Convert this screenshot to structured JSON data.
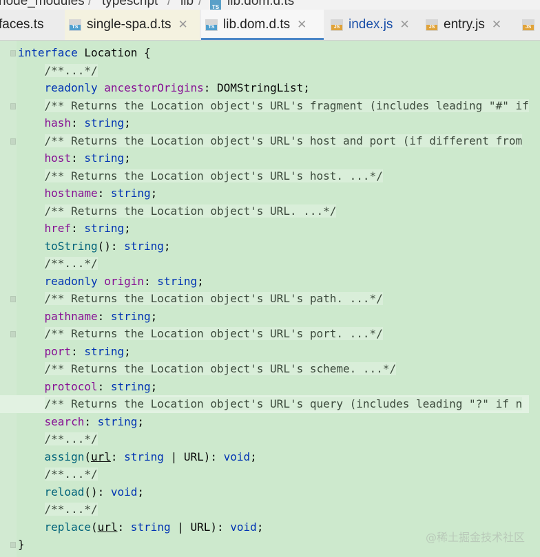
{
  "breadcrumb": {
    "items": [
      "node_modules",
      "typescript",
      "lib",
      "lib.dom.d.ts"
    ]
  },
  "tabs": [
    {
      "label": "faces.ts",
      "icon": "ts-file-icon",
      "state": "inactive"
    },
    {
      "label": "single-spa.d.ts",
      "icon": "ts-file-icon",
      "state": "inactive-alt"
    },
    {
      "label": "lib.dom.d.ts",
      "icon": "ts-file-icon",
      "state": "active"
    },
    {
      "label": "index.js",
      "icon": "js-file-icon",
      "state": "inactive"
    },
    {
      "label": "entry.js",
      "icon": "js-file-icon",
      "state": "inactive"
    }
  ],
  "icon_labels": {
    "ts": "TS",
    "js": "JS"
  },
  "code_lines": [
    [
      {
        "t": "interface",
        "c": "kw"
      },
      {
        "t": " Location {",
        "c": "punc"
      }
    ],
    [
      {
        "t": "    ",
        "c": "punc"
      },
      {
        "t": "/**...*/",
        "c": "cmt"
      }
    ],
    [
      {
        "t": "    ",
        "c": "punc"
      },
      {
        "t": "readonly",
        "c": "kw"
      },
      {
        "t": " ",
        "c": "punc"
      },
      {
        "t": "ancestorOrigins",
        "c": "prop"
      },
      {
        "t": ": DOMStringList;",
        "c": "punc"
      }
    ],
    [
      {
        "t": "    ",
        "c": "punc"
      },
      {
        "t": "/** Returns the Location object's URL's fragment (includes leading \"#\" if",
        "c": "cmt"
      }
    ],
    [
      {
        "t": "    ",
        "c": "punc"
      },
      {
        "t": "hash",
        "c": "prop"
      },
      {
        "t": ": ",
        "c": "punc"
      },
      {
        "t": "string",
        "c": "kw"
      },
      {
        "t": ";",
        "c": "punc"
      }
    ],
    [
      {
        "t": "    ",
        "c": "punc"
      },
      {
        "t": "/** Returns the Location object's URL's host and port (if different from",
        "c": "cmt"
      }
    ],
    [
      {
        "t": "    ",
        "c": "punc"
      },
      {
        "t": "host",
        "c": "prop"
      },
      {
        "t": ": ",
        "c": "punc"
      },
      {
        "t": "string",
        "c": "kw"
      },
      {
        "t": ";",
        "c": "punc"
      }
    ],
    [
      {
        "t": "    ",
        "c": "punc"
      },
      {
        "t": "/** Returns the Location object's URL's host. ...*/",
        "c": "cmt"
      }
    ],
    [
      {
        "t": "    ",
        "c": "punc"
      },
      {
        "t": "hostname",
        "c": "prop"
      },
      {
        "t": ": ",
        "c": "punc"
      },
      {
        "t": "string",
        "c": "kw"
      },
      {
        "t": ";",
        "c": "punc"
      }
    ],
    [
      {
        "t": "    ",
        "c": "punc"
      },
      {
        "t": "/** Returns the Location object's URL. ...*/",
        "c": "cmt"
      }
    ],
    [
      {
        "t": "    ",
        "c": "punc"
      },
      {
        "t": "href",
        "c": "prop"
      },
      {
        "t": ": ",
        "c": "punc"
      },
      {
        "t": "string",
        "c": "kw"
      },
      {
        "t": ";",
        "c": "punc"
      }
    ],
    [
      {
        "t": "    ",
        "c": "punc"
      },
      {
        "t": "toString",
        "c": "fn"
      },
      {
        "t": "(): ",
        "c": "punc"
      },
      {
        "t": "string",
        "c": "kw"
      },
      {
        "t": ";",
        "c": "punc"
      }
    ],
    [
      {
        "t": "    ",
        "c": "punc"
      },
      {
        "t": "/**...*/",
        "c": "cmt"
      }
    ],
    [
      {
        "t": "    ",
        "c": "punc"
      },
      {
        "t": "readonly",
        "c": "kw"
      },
      {
        "t": " ",
        "c": "punc"
      },
      {
        "t": "origin",
        "c": "prop"
      },
      {
        "t": ": ",
        "c": "punc"
      },
      {
        "t": "string",
        "c": "kw"
      },
      {
        "t": ";",
        "c": "punc"
      }
    ],
    [
      {
        "t": "    ",
        "c": "punc"
      },
      {
        "t": "/** Returns the Location object's URL's path. ...*/",
        "c": "cmt"
      }
    ],
    [
      {
        "t": "    ",
        "c": "punc"
      },
      {
        "t": "pathname",
        "c": "prop"
      },
      {
        "t": ": ",
        "c": "punc"
      },
      {
        "t": "string",
        "c": "kw"
      },
      {
        "t": ";",
        "c": "punc"
      }
    ],
    [
      {
        "t": "    ",
        "c": "punc"
      },
      {
        "t": "/** Returns the Location object's URL's port. ...*/",
        "c": "cmt"
      }
    ],
    [
      {
        "t": "    ",
        "c": "punc"
      },
      {
        "t": "port",
        "c": "prop"
      },
      {
        "t": ": ",
        "c": "punc"
      },
      {
        "t": "string",
        "c": "kw"
      },
      {
        "t": ";",
        "c": "punc"
      }
    ],
    [
      {
        "t": "    ",
        "c": "punc"
      },
      {
        "t": "/** Returns the Location object's URL's scheme. ...*/",
        "c": "cmt"
      }
    ],
    [
      {
        "t": "    ",
        "c": "punc"
      },
      {
        "t": "protocol",
        "c": "prop"
      },
      {
        "t": ": ",
        "c": "punc"
      },
      {
        "t": "string",
        "c": "kw"
      },
      {
        "t": ";",
        "c": "punc"
      }
    ],
    [
      {
        "t": "    ",
        "c": "punc"
      },
      {
        "t": "/** Returns the Location object's URL's query (includes leading \"?\" if n",
        "c": "cmt"
      }
    ],
    [
      {
        "t": "    ",
        "c": "punc"
      },
      {
        "t": "search",
        "c": "prop"
      },
      {
        "t": ": ",
        "c": "punc"
      },
      {
        "t": "string",
        "c": "kw"
      },
      {
        "t": ";",
        "c": "punc"
      }
    ],
    [
      {
        "t": "    ",
        "c": "punc"
      },
      {
        "t": "/**...*/",
        "c": "cmt"
      }
    ],
    [
      {
        "t": "    ",
        "c": "punc"
      },
      {
        "t": "assign",
        "c": "fn"
      },
      {
        "t": "(",
        "c": "punc"
      },
      {
        "t": "url",
        "c": "param"
      },
      {
        "t": ": ",
        "c": "punc"
      },
      {
        "t": "string",
        "c": "kw"
      },
      {
        "t": " | URL): ",
        "c": "punc"
      },
      {
        "t": "void",
        "c": "kw"
      },
      {
        "t": ";",
        "c": "punc"
      }
    ],
    [
      {
        "t": "    ",
        "c": "punc"
      },
      {
        "t": "/**...*/",
        "c": "cmt"
      }
    ],
    [
      {
        "t": "    ",
        "c": "punc"
      },
      {
        "t": "reload",
        "c": "fn"
      },
      {
        "t": "(): ",
        "c": "punc"
      },
      {
        "t": "void",
        "c": "kw"
      },
      {
        "t": ";",
        "c": "punc"
      }
    ],
    [
      {
        "t": "    ",
        "c": "punc"
      },
      {
        "t": "/**...*/",
        "c": "cmt"
      }
    ],
    [
      {
        "t": "    ",
        "c": "punc"
      },
      {
        "t": "replace",
        "c": "fn"
      },
      {
        "t": "(",
        "c": "punc"
      },
      {
        "t": "url",
        "c": "param"
      },
      {
        "t": ": ",
        "c": "punc"
      },
      {
        "t": "string",
        "c": "kw"
      },
      {
        "t": " | URL): ",
        "c": "punc"
      },
      {
        "t": "void",
        "c": "kw"
      },
      {
        "t": ";",
        "c": "punc"
      }
    ],
    [
      {
        "t": "}",
        "c": "punc"
      }
    ]
  ],
  "current_line_index": 20,
  "gutter_marker_lines": [
    0,
    3,
    5,
    14,
    16,
    20,
    28
  ],
  "watermark": "@稀土掘金技术社区",
  "colors": {
    "editor_background": "#cde9cd",
    "keyword": "#0033b3",
    "property": "#871094",
    "function": "#00627a",
    "active_tab_underline": "#4a86c6"
  }
}
